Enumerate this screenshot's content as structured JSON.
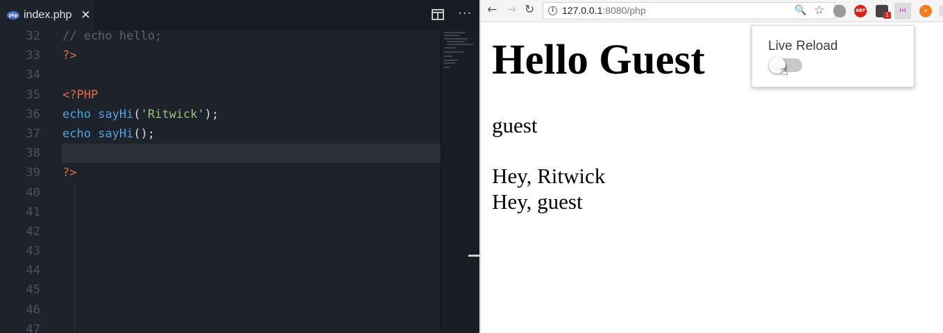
{
  "editor": {
    "tab": {
      "icon": "php-file-icon",
      "title": "index.php",
      "close": "✕"
    },
    "toolbar": {
      "split": "split-editor-icon",
      "more": "···"
    },
    "line_numbers": [
      "32",
      "33",
      "34",
      "35",
      "36",
      "37",
      "38",
      "39",
      "40",
      "41",
      "42",
      "43",
      "44",
      "45",
      "46",
      "47"
    ],
    "lines": [
      [
        {
          "t": "// echo hello;",
          "c": "comment"
        }
      ],
      [
        {
          "t": "?>",
          "c": "tag"
        }
      ],
      [],
      [
        {
          "t": "<?PHP",
          "c": "tag"
        }
      ],
      [
        {
          "t": "echo",
          "c": "kw"
        },
        {
          "t": " ",
          "c": "punc"
        },
        {
          "t": "sayHi",
          "c": "fn"
        },
        {
          "t": "(",
          "c": "punc"
        },
        {
          "t": "'Ritwick'",
          "c": "str"
        },
        {
          "t": ");",
          "c": "punc"
        }
      ],
      [
        {
          "t": "echo",
          "c": "kw"
        },
        {
          "t": " ",
          "c": "punc"
        },
        {
          "t": "sayHi",
          "c": "fn"
        },
        {
          "t": "();",
          "c": "punc"
        }
      ],
      [],
      [
        {
          "t": "?>",
          "c": "tag"
        }
      ],
      [],
      [],
      [],
      [],
      [],
      [],
      [],
      []
    ],
    "current_line": "38"
  },
  "browser": {
    "nav": {
      "back": "←",
      "forward": "→",
      "reload": "↻"
    },
    "url": {
      "host": "127.0.0.1",
      "rest": ":8080/php"
    },
    "omnibox_icons": {
      "info": "i",
      "zoom": "🔍",
      "star": "☆"
    },
    "extensions": {
      "abp": "ABP",
      "badge": "1",
      "livereload": "(•)",
      "orange": "✕"
    },
    "page": {
      "heading": "Hello Guest",
      "line1": "guest",
      "line2": "Hey, Ritwick",
      "line3": "Hey, guest"
    },
    "popup": {
      "title": "Live Reload",
      "toggle_on": false,
      "cursor": "☝"
    }
  }
}
